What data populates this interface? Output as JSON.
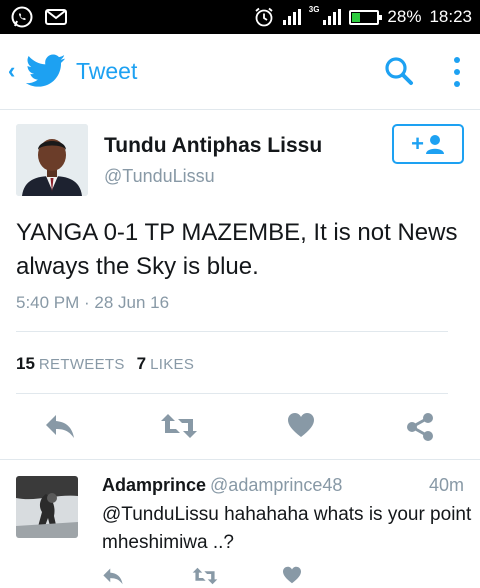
{
  "status_bar": {
    "network_type": "3G",
    "battery_percent": "28%",
    "battery_level": 0.28,
    "time": "18:23",
    "icons": [
      "whatsapp-icon",
      "mail-icon",
      "alarm-icon",
      "signal-icon",
      "battery-icon"
    ]
  },
  "app_bar": {
    "title": "Tweet",
    "icons": [
      "back-chevron-icon",
      "twitter-bird-icon",
      "search-icon",
      "more-vert-icon"
    ]
  },
  "tweet": {
    "author_name": "Tundu Antiphas Lissu",
    "author_handle": "@TunduLissu",
    "follow_label": "+",
    "text": "YANGA 0-1 TP MAZEMBE, It is not News always the Sky is blue.",
    "timestamp": "5:40 PM · 28 Jun 16",
    "retweets_count": "15",
    "retweets_label": "RETWEETS",
    "likes_count": "7",
    "likes_label": "LIKES",
    "actions": [
      "reply-icon",
      "retweet-icon",
      "like-icon",
      "share-icon"
    ]
  },
  "reply": {
    "name": "Adamprince",
    "handle": "@adamprince48",
    "time": "40m",
    "text": "@TunduLissu hahahaha whats is your point mheshimiwa ..?",
    "actions": [
      "reply-icon",
      "retweet-icon",
      "like-icon"
    ]
  },
  "colors": {
    "accent": "#1da1f2",
    "action_gray": "#8899a6",
    "text": "#14171a"
  }
}
